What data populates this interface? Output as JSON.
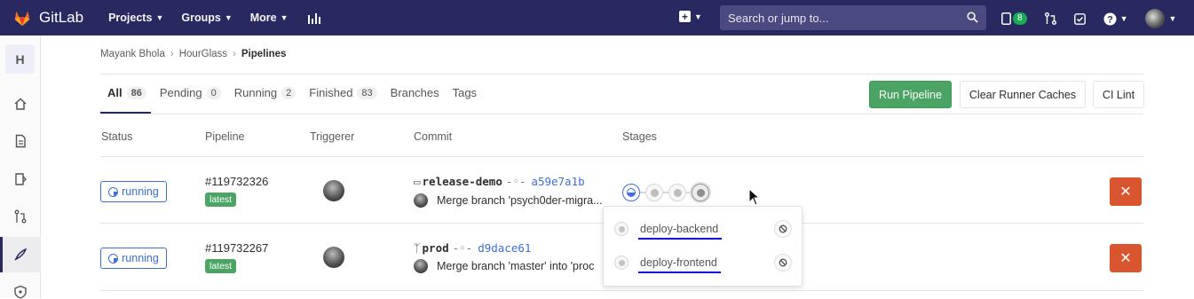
{
  "nav": {
    "brand": "GitLab",
    "projects": "Projects",
    "groups": "Groups",
    "more": "More",
    "search_placeholder": "Search or jump to...",
    "todo_count": "8"
  },
  "sidebar": {
    "project_initial": "H"
  },
  "breadcrumb": {
    "user": "Mayank Bhola",
    "project": "HourGlass",
    "current": "Pipelines"
  },
  "tabs": [
    {
      "label": "All",
      "count": "86"
    },
    {
      "label": "Pending",
      "count": "0"
    },
    {
      "label": "Running",
      "count": "2"
    },
    {
      "label": "Finished",
      "count": "83"
    },
    {
      "label": "Branches"
    },
    {
      "label": "Tags"
    }
  ],
  "actions": {
    "run_pipeline": "Run Pipeline",
    "clear_caches": "Clear Runner Caches",
    "ci_lint": "CI Lint"
  },
  "columns": {
    "status": "Status",
    "pipeline": "Pipeline",
    "triggerer": "Triggerer",
    "commit": "Commit",
    "stages": "Stages"
  },
  "pipelines": [
    {
      "status": "running",
      "id": "#119732326",
      "tag": "latest",
      "ref": "release-demo",
      "sha": "a59e7a1b",
      "message": "Merge branch 'psych0der-migra..."
    },
    {
      "status": "running",
      "id": "#119732267",
      "tag": "latest",
      "ref": "prod",
      "sha": "d9dace61",
      "message": "Merge branch 'master' into 'proc"
    }
  ],
  "stage_dropdown": [
    {
      "job": "deploy-backend"
    },
    {
      "job": "deploy-frontend"
    }
  ],
  "colors": {
    "navbar": "#292961",
    "running": "#3b6fd6",
    "success": "#4ba464",
    "danger": "#d8552f"
  }
}
